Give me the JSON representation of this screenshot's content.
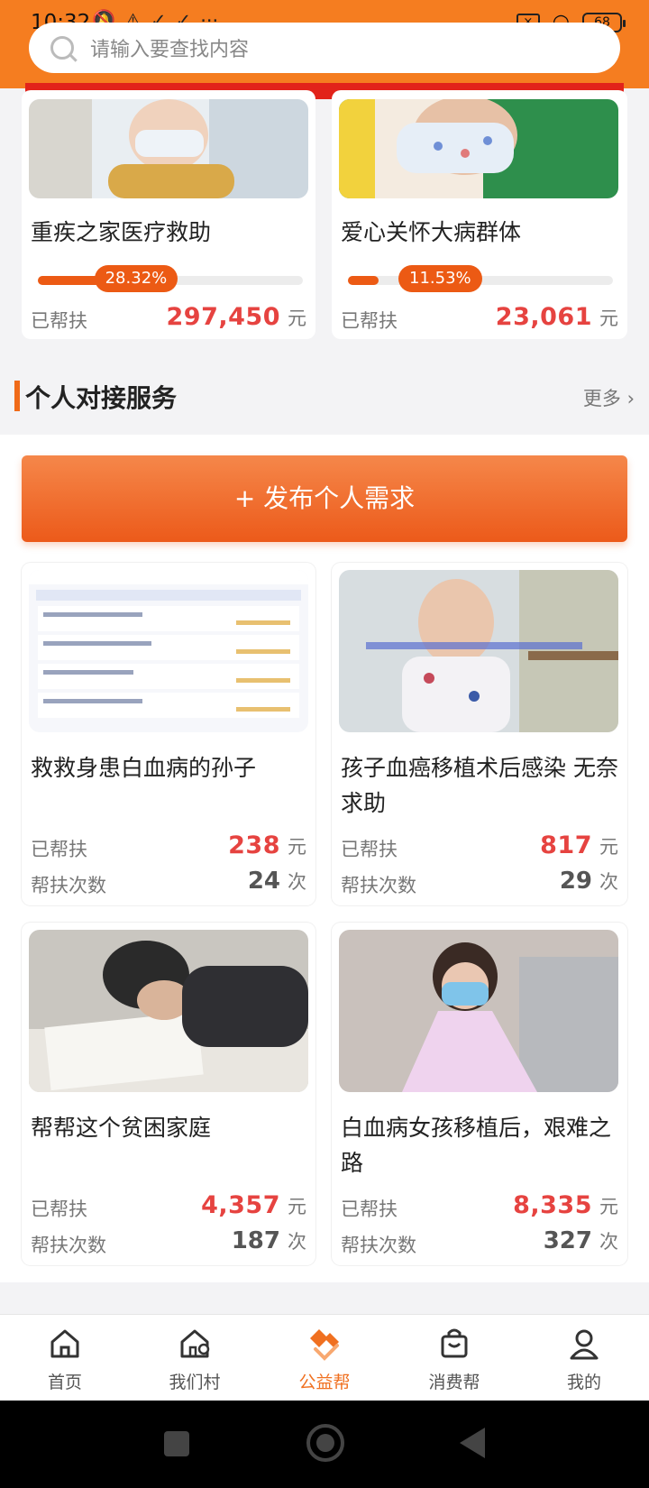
{
  "status_bar": {
    "time": "10:32",
    "battery": "68"
  },
  "search": {
    "placeholder": "请输入要查找内容"
  },
  "top_cards": [
    {
      "title": "重疾之家医疗救助",
      "progress_label": "28.32%",
      "progress": 0.2832,
      "helped_label": "已帮扶",
      "amount": "297,450",
      "unit": "元"
    },
    {
      "title": "爱心关怀大病群体",
      "progress_label": "11.53%",
      "progress": 0.1153,
      "helped_label": "已帮扶",
      "amount": "23,061",
      "unit": "元"
    }
  ],
  "section": {
    "title": "个人对接服务",
    "more": "更多 ›"
  },
  "publish_button": "+ 发布个人需求",
  "requests": [
    {
      "title": "救救身患白血病的孙子",
      "helped_label": "已帮扶",
      "amount": "238",
      "amount_unit": "元",
      "count_label": "帮扶次数",
      "count": "24",
      "count_unit": "次"
    },
    {
      "title": "孩子血癌移植术后感染 无奈求助",
      "helped_label": "已帮扶",
      "amount": "817",
      "amount_unit": "元",
      "count_label": "帮扶次数",
      "count": "29",
      "count_unit": "次"
    },
    {
      "title": "帮帮这个贫困家庭",
      "helped_label": "已帮扶",
      "amount": "4,357",
      "amount_unit": "元",
      "count_label": "帮扶次数",
      "count": "187",
      "count_unit": "次"
    },
    {
      "title": "白血病女孩移植后，艰难之路",
      "helped_label": "已帮扶",
      "amount": "8,335",
      "amount_unit": "元",
      "count_label": "帮扶次数",
      "count": "327",
      "count_unit": "次"
    }
  ],
  "bottom_nav": [
    {
      "label": "首页",
      "icon": "home-icon"
    },
    {
      "label": "我们村",
      "icon": "village-icon"
    },
    {
      "label": "公益帮",
      "icon": "charity-icon",
      "active": true
    },
    {
      "label": "消费帮",
      "icon": "shopping-bag-icon"
    },
    {
      "label": "我的",
      "icon": "profile-icon"
    }
  ],
  "colors": {
    "brand_orange": "#f57d20",
    "accent_red": "#e64340",
    "active_nav": "#f07020"
  }
}
